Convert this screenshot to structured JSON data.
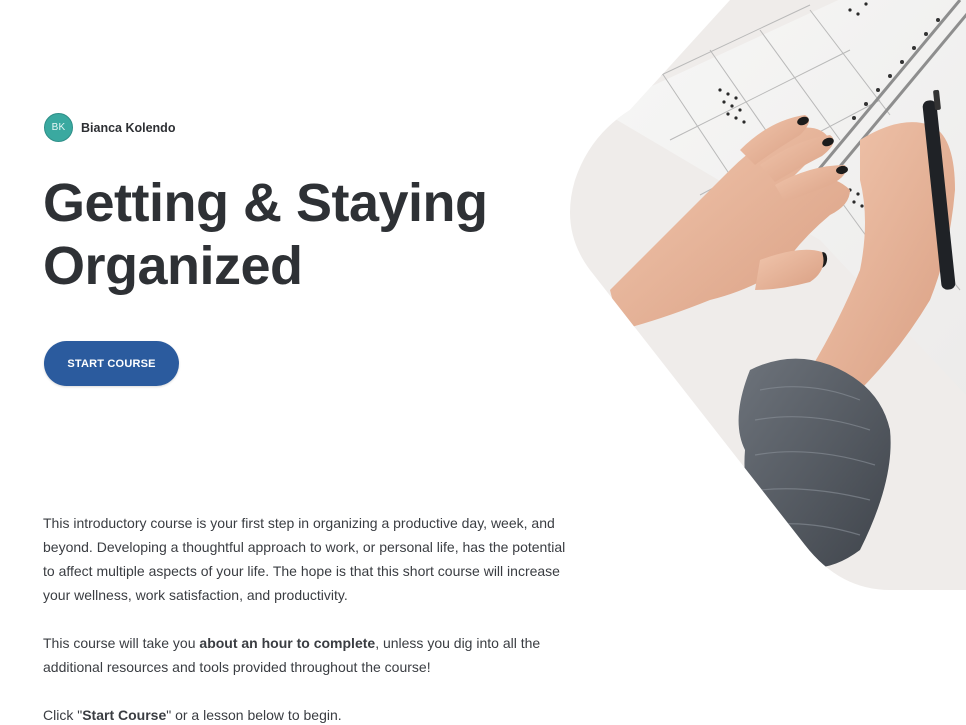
{
  "author": {
    "initials": "BK",
    "name": "Bianca Kolendo"
  },
  "course": {
    "title_line1": "Getting & Staying",
    "title_line2": "Organized",
    "start_button": "START COURSE"
  },
  "description": {
    "paragraph1": "This introductory course is your first step in organizing a productive day, week, and beyond. Developing a thoughtful approach to work, or personal life, has the potential to affect multiple aspects of your life. The hope is that this short course will increase your wellness, work satisfaction, and productivity.",
    "paragraph2_before": "This course will take you ",
    "paragraph2_bold": "about an hour to complete",
    "paragraph2_after": ", unless you dig into all the additional resources and tools provided throughout the course!",
    "paragraph3_before": "Click \"",
    "paragraph3_bold": "Start Course",
    "paragraph3_after": "\" or a lesson below to begin."
  },
  "hero_image": {
    "icon": "planner-hands-photo"
  },
  "colors": {
    "accent": "#2b5b9e",
    "avatar": "#3aa9a0",
    "text": "#2d2f33"
  }
}
